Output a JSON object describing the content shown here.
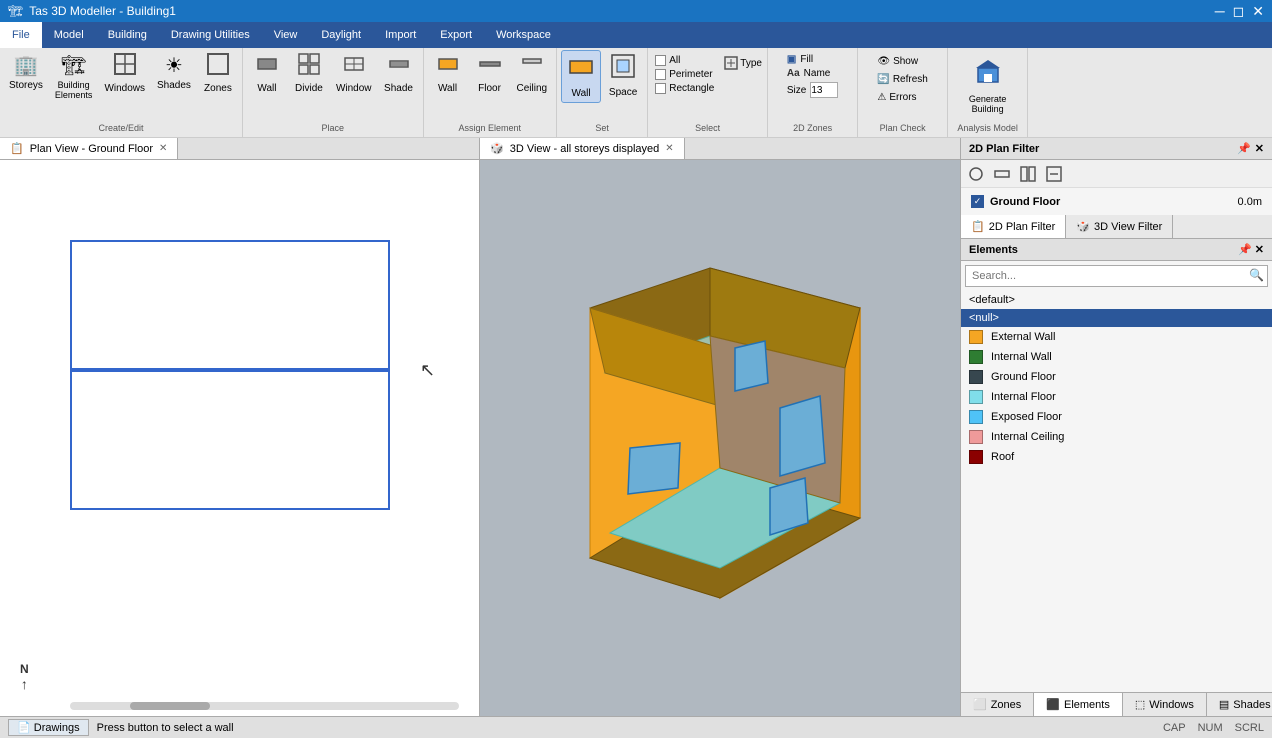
{
  "titleBar": {
    "appIcon": "🏗",
    "title": "Tas 3D Modeller - Building1",
    "minimizeIcon": "─",
    "restoreIcon": "◻",
    "closeIcon": "✕"
  },
  "menuBar": {
    "items": [
      {
        "id": "file",
        "label": "File",
        "active": true
      },
      {
        "id": "model",
        "label": "Model"
      },
      {
        "id": "building",
        "label": "Building"
      },
      {
        "id": "drawing-utilities",
        "label": "Drawing Utilities"
      },
      {
        "id": "view",
        "label": "View"
      },
      {
        "id": "daylight",
        "label": "Daylight"
      },
      {
        "id": "import",
        "label": "Import"
      },
      {
        "id": "export",
        "label": "Export"
      },
      {
        "id": "workspace",
        "label": "Workspace"
      }
    ]
  },
  "ribbon": {
    "groups": [
      {
        "id": "create-edit",
        "label": "Create/Edit",
        "buttons": [
          {
            "id": "storeys",
            "icon": "🏢",
            "label": "Storeys"
          },
          {
            "id": "building-elements",
            "icon": "🏗",
            "label": "Building\nElements"
          },
          {
            "id": "windows",
            "icon": "⬛",
            "label": "Windows"
          },
          {
            "id": "shades",
            "icon": "☀",
            "label": "Shades"
          },
          {
            "id": "zones",
            "icon": "⬜",
            "label": "Zones"
          }
        ]
      },
      {
        "id": "place",
        "label": "Place",
        "buttons": [
          {
            "id": "wall-place",
            "icon": "▭",
            "label": "Wall"
          },
          {
            "id": "divide",
            "icon": "⧈",
            "label": "Divide"
          },
          {
            "id": "window-place",
            "icon": "⬚",
            "label": "Window"
          },
          {
            "id": "shade-place",
            "icon": "▤",
            "label": "Shade"
          }
        ]
      },
      {
        "id": "assign-element",
        "label": "Assign Element",
        "buttons": [
          {
            "id": "wall-assign",
            "icon": "▭",
            "label": "Wall"
          },
          {
            "id": "floor-assign",
            "icon": "▬",
            "label": "Floor"
          },
          {
            "id": "ceiling-assign",
            "icon": "▭",
            "label": "Ceiling"
          }
        ]
      },
      {
        "id": "set",
        "label": "Set",
        "buttons": [
          {
            "id": "wall-set",
            "icon": "▭",
            "label": "Wall",
            "active": true
          },
          {
            "id": "space-set",
            "icon": "⬚",
            "label": "Space"
          }
        ]
      },
      {
        "id": "select",
        "label": "Select",
        "checkboxes": [
          {
            "id": "all",
            "label": "All",
            "checked": false
          },
          {
            "id": "perimeter",
            "label": "Perimeter",
            "checked": false
          },
          {
            "id": "rectangle",
            "label": "Rectangle",
            "checked": false
          }
        ],
        "typeBtn": {
          "label": "Type",
          "checked": false
        }
      },
      {
        "id": "2d-zones",
        "label": "2D Zones",
        "fill": "Fill",
        "name": "Name",
        "size": "13"
      },
      {
        "id": "plan-check",
        "label": "Plan Check",
        "buttons": [
          {
            "id": "show",
            "label": "Show"
          },
          {
            "id": "refresh",
            "label": "Refresh"
          },
          {
            "id": "errors",
            "label": "Errors"
          }
        ]
      },
      {
        "id": "analysis-model",
        "label": "Analysis Model",
        "buttons": [
          {
            "id": "generate-building",
            "label": "Generate Building",
            "icon": "🏗"
          }
        ]
      }
    ]
  },
  "planView": {
    "tabLabel": "Plan View - Ground Floor",
    "tabIcon": "📋"
  },
  "threeDView": {
    "tabLabel": "3D View - all storeys displayed",
    "tabIcon": "🎲"
  },
  "rightPanel": {
    "title": "2D Plan Filter",
    "filterTabs": [
      {
        "id": "2d-plan-filter",
        "label": "2D Plan Filter",
        "active": true
      },
      {
        "id": "3d-view-filter",
        "label": "3D View Filter",
        "active": false
      }
    ],
    "floors": [
      {
        "id": "ground-floor",
        "name": "Ground Floor",
        "level": "0.0m",
        "checked": true
      }
    ],
    "elementsTitle": "Elements",
    "searchPlaceholder": "Search...",
    "elementItems": [
      {
        "id": "default",
        "label": "<default>",
        "indent": false,
        "color": null
      },
      {
        "id": "null",
        "label": "<null>",
        "indent": false,
        "color": null,
        "selected": true
      },
      {
        "id": "external-wall",
        "label": "External Wall",
        "indent": false,
        "color": "#F5A623"
      },
      {
        "id": "internal-wall",
        "label": "Internal Wall",
        "indent": false,
        "color": "#2E7D32"
      },
      {
        "id": "ground-floor-elem",
        "label": "Ground Floor",
        "indent": false,
        "color": "#37474F"
      },
      {
        "id": "internal-floor",
        "label": "Internal Floor",
        "indent": false,
        "color": "#80DEEA"
      },
      {
        "id": "exposed-floor",
        "label": "Exposed Floor",
        "indent": false,
        "color": "#4FC3F7"
      },
      {
        "id": "internal-ceiling",
        "label": "Internal Ceiling",
        "indent": false,
        "color": "#EF9A9A"
      },
      {
        "id": "roof",
        "label": "Roof",
        "indent": false,
        "color": "#8B0000"
      }
    ],
    "bottomTabs": [
      {
        "id": "zones",
        "label": "Zones",
        "icon": "⬜"
      },
      {
        "id": "elements",
        "label": "Elements",
        "icon": "⬛",
        "active": true
      },
      {
        "id": "windows",
        "label": "Windows",
        "icon": "⬚"
      },
      {
        "id": "shades",
        "label": "Shades",
        "icon": "▤"
      }
    ]
  },
  "statusBar": {
    "message": "Press button to select a wall",
    "indicators": [
      "CAP",
      "NUM",
      "SCRL"
    ]
  }
}
